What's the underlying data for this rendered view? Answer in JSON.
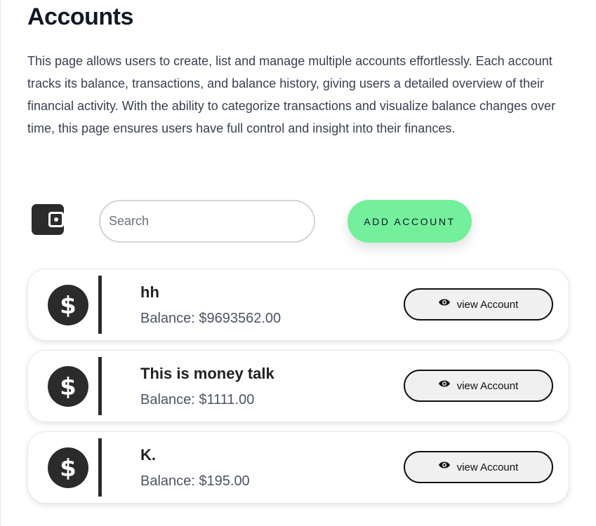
{
  "header": {
    "title": "Accounts",
    "description": "This page allows users to create, list and manage multiple accounts effortlessly. Each account tracks its balance, transactions, and balance history, giving users a detailed overview of their financial activity. With the ability to categorize transactions and visualize balance changes over time, this page ensures users have full control and insight into their finances."
  },
  "toolbar": {
    "icon": "wallet-icon",
    "search": {
      "placeholder": "Search",
      "value": ""
    },
    "add_label": "ADD ACCOUNT",
    "add_color": "#74ef9c"
  },
  "accounts": [
    {
      "icon": "dollar-icon",
      "name": "hh",
      "balance": "Balance: $9693562.00",
      "view_label": "view Account"
    },
    {
      "icon": "dollar-icon",
      "name": "This is money talk",
      "balance": "Balance: $1111.00",
      "view_label": "view Account"
    },
    {
      "icon": "dollar-icon",
      "name": "K.",
      "balance": "Balance: $195.00",
      "view_label": "view Account"
    }
  ]
}
